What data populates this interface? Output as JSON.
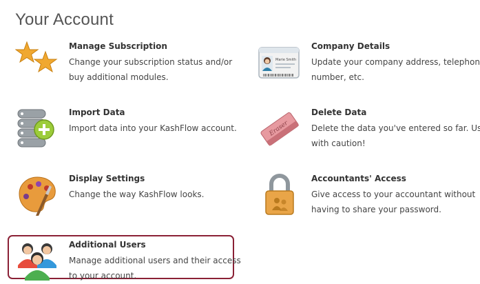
{
  "page": {
    "title": "Your Account"
  },
  "tiles": [
    {
      "id": "manage-subscription",
      "title": "Manage Subscription",
      "desc": "Change your subscription status and/or buy additional modules.",
      "icon": "stars-icon"
    },
    {
      "id": "company-details",
      "title": "Company Details",
      "desc": "Update your company address, telephone number, etc.",
      "icon": "id-card-icon"
    },
    {
      "id": "import-data",
      "title": "Import Data",
      "desc": "Import data into your KashFlow account.",
      "icon": "database-add-icon"
    },
    {
      "id": "delete-data",
      "title": "Delete Data",
      "desc": "Delete the data you've entered so far. Use with caution!",
      "icon": "eraser-icon"
    },
    {
      "id": "display-settings",
      "title": "Display Settings",
      "desc": "Change the way KashFlow looks.",
      "icon": "palette-icon"
    },
    {
      "id": "accountants-access",
      "title": "Accountants' Access",
      "desc": "Give access to your accountant without having to share your password.",
      "icon": "padlock-icon"
    },
    {
      "id": "additional-users",
      "title": "Additional Users",
      "desc": "Manage additional users and their access to your account.",
      "icon": "users-icon"
    }
  ],
  "id_card": {
    "badge_text": "Marie Smith"
  },
  "eraser": {
    "label": "Eraser"
  },
  "colors": {
    "highlight_border": "#8a2035",
    "title": "#555555",
    "text": "#444444"
  }
}
